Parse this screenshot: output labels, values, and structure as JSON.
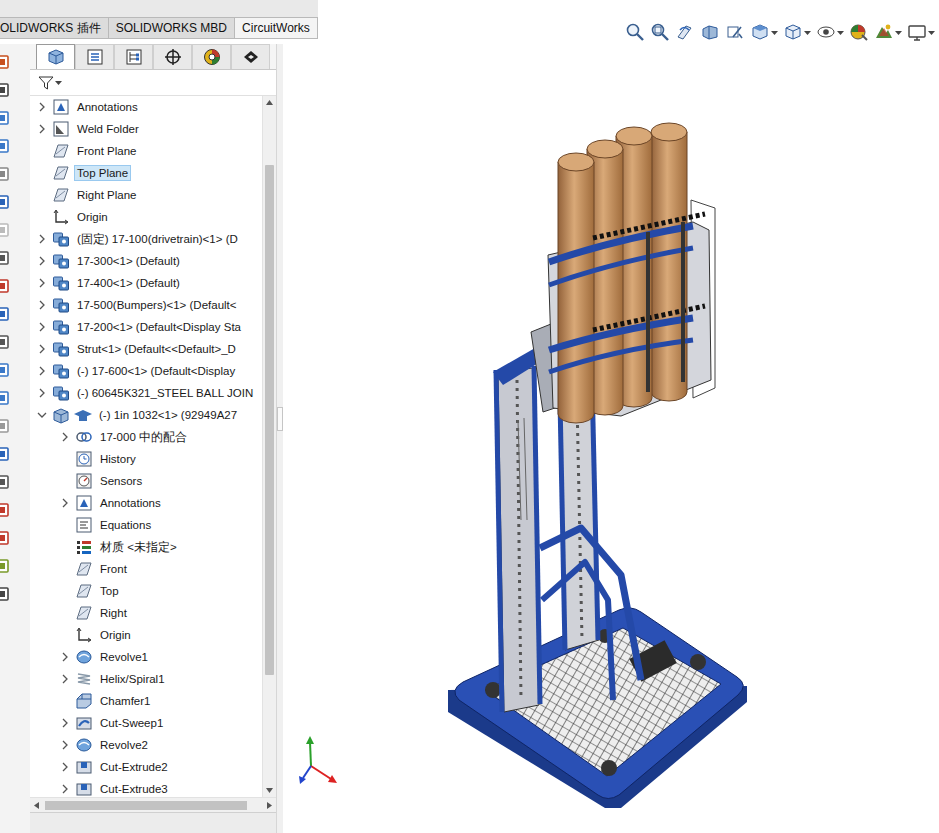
{
  "ribbon_tabs": [
    {
      "label": "OLIDWORKS 插件"
    },
    {
      "label": "SOLIDWORKS MBD"
    },
    {
      "label": "CircuitWorks"
    }
  ],
  "panel_tabs": [
    {
      "kind": "feature-manager",
      "selected": true
    },
    {
      "kind": "property-manager",
      "selected": false
    },
    {
      "kind": "configuration-manager",
      "selected": false
    },
    {
      "kind": "dimxpert-manager",
      "selected": false
    },
    {
      "kind": "display-manager",
      "selected": false
    },
    {
      "kind": "cam-manager",
      "selected": false
    }
  ],
  "tree": [
    {
      "label": "Annotations",
      "kind": "annotations",
      "indent": 0,
      "expandable": true,
      "expanded": false,
      "selected": false
    },
    {
      "label": "Weld Folder",
      "kind": "weld-folder",
      "indent": 0,
      "expandable": true,
      "expanded": false,
      "selected": false
    },
    {
      "label": "Front Plane",
      "kind": "plane",
      "indent": 0,
      "expandable": false,
      "expanded": false,
      "selected": false
    },
    {
      "label": "Top Plane",
      "kind": "plane",
      "indent": 0,
      "expandable": false,
      "expanded": false,
      "selected": true
    },
    {
      "label": "Right Plane",
      "kind": "plane",
      "indent": 0,
      "expandable": false,
      "expanded": false,
      "selected": false
    },
    {
      "label": "Origin",
      "kind": "origin",
      "indent": 0,
      "expandable": false,
      "expanded": false,
      "selected": false
    },
    {
      "label": "(固定) 17-100(drivetrain)<1> (D",
      "kind": "assembly",
      "indent": 0,
      "expandable": true,
      "expanded": false,
      "selected": false
    },
    {
      "label": "17-300<1> (Default)",
      "kind": "assembly",
      "indent": 0,
      "expandable": true,
      "expanded": false,
      "selected": false
    },
    {
      "label": "17-400<1> (Default)",
      "kind": "assembly",
      "indent": 0,
      "expandable": true,
      "expanded": false,
      "selected": false
    },
    {
      "label": "17-500(Bumpers)<1> (Default<",
      "kind": "assembly",
      "indent": 0,
      "expandable": true,
      "expanded": false,
      "selected": false
    },
    {
      "label": "17-200<1> (Default<Display Sta",
      "kind": "assembly",
      "indent": 0,
      "expandable": true,
      "expanded": false,
      "selected": false
    },
    {
      "label": "Strut<1> (Default<<Default>_D",
      "kind": "assembly",
      "indent": 0,
      "expandable": true,
      "expanded": false,
      "selected": false
    },
    {
      "label": "(-) 17-600<1> (Default<Display",
      "kind": "assembly",
      "indent": 0,
      "expandable": true,
      "expanded": false,
      "selected": false
    },
    {
      "label": "(-) 60645K321_STEEL BALL JOIN",
      "kind": "assembly",
      "indent": 0,
      "expandable": true,
      "expanded": false,
      "selected": false
    },
    {
      "label": "(-) 1in 1032<1> (92949A27",
      "kind": "toolbox-part",
      "indent": 0,
      "expandable": true,
      "expanded": true,
      "selected": false
    },
    {
      "label": "17-000 中的配合",
      "kind": "mates",
      "indent": 1,
      "expandable": true,
      "expanded": false,
      "selected": false
    },
    {
      "label": "History",
      "kind": "history",
      "indent": 1,
      "expandable": false,
      "expanded": false,
      "selected": false
    },
    {
      "label": "Sensors",
      "kind": "sensors",
      "indent": 1,
      "expandable": false,
      "expanded": false,
      "selected": false
    },
    {
      "label": "Annotations",
      "kind": "annotations",
      "indent": 1,
      "expandable": true,
      "expanded": false,
      "selected": false
    },
    {
      "label": "Equations",
      "kind": "equations",
      "indent": 1,
      "expandable": false,
      "expanded": false,
      "selected": false
    },
    {
      "label": "材质 <未指定>",
      "kind": "material",
      "indent": 1,
      "expandable": false,
      "expanded": false,
      "selected": false
    },
    {
      "label": "Front",
      "kind": "plane",
      "indent": 1,
      "expandable": false,
      "expanded": false,
      "selected": false
    },
    {
      "label": "Top",
      "kind": "plane",
      "indent": 1,
      "expandable": false,
      "expanded": false,
      "selected": false
    },
    {
      "label": "Right",
      "kind": "plane",
      "indent": 1,
      "expandable": false,
      "expanded": false,
      "selected": false
    },
    {
      "label": "Origin",
      "kind": "origin",
      "indent": 1,
      "expandable": false,
      "expanded": false,
      "selected": false
    },
    {
      "label": "Revolve1",
      "kind": "revolve",
      "indent": 1,
      "expandable": true,
      "expanded": false,
      "selected": false
    },
    {
      "label": "Helix/Spiral1",
      "kind": "helix",
      "indent": 1,
      "expandable": true,
      "expanded": false,
      "selected": false
    },
    {
      "label": "Chamfer1",
      "kind": "chamfer",
      "indent": 1,
      "expandable": false,
      "expanded": false,
      "selected": false
    },
    {
      "label": "Cut-Sweep1",
      "kind": "cut-sweep",
      "indent": 1,
      "expandable": true,
      "expanded": false,
      "selected": false
    },
    {
      "label": "Revolve2",
      "kind": "revolve",
      "indent": 1,
      "expandable": true,
      "expanded": false,
      "selected": false
    },
    {
      "label": "Cut-Extrude2",
      "kind": "cut-extrude",
      "indent": 1,
      "expandable": true,
      "expanded": false,
      "selected": false
    },
    {
      "label": "Cut-Extrude3",
      "kind": "cut-extrude",
      "indent": 1,
      "expandable": true,
      "expanded": false,
      "selected": false
    }
  ]
}
